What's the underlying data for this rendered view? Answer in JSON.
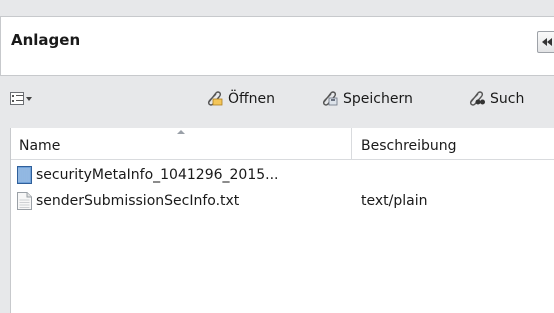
{
  "panel": {
    "title": "Anlagen"
  },
  "toolbar": {
    "open_label": "Öffnen",
    "save_label": "Speichern",
    "search_label": "Such"
  },
  "table": {
    "columns": [
      "Name",
      "Beschreibung"
    ],
    "rows": [
      {
        "name": "securityMetaInfo_1041296_2015...",
        "description": "",
        "icon": "document-blue-icon"
      },
      {
        "name": "senderSubmissionSecInfo.txt",
        "description": "text/plain",
        "icon": "text-file-icon"
      }
    ]
  },
  "colors": {
    "background": "#e7e8ea",
    "panel": "#ffffff",
    "border": "#c7c9cc"
  }
}
